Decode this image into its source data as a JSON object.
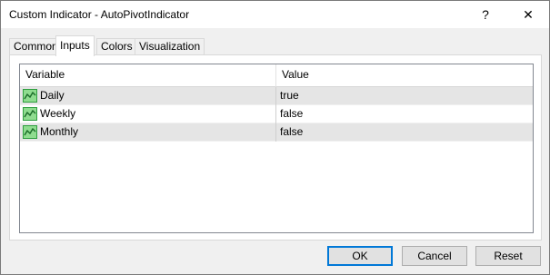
{
  "window": {
    "title": "Custom Indicator - AutoPivotIndicator",
    "help_label": "?",
    "close_label": "✕"
  },
  "tabs": [
    {
      "label": "Common",
      "active": false
    },
    {
      "label": "Inputs",
      "active": true
    },
    {
      "label": "Colors",
      "active": false
    },
    {
      "label": "Visualization",
      "active": false
    }
  ],
  "grid": {
    "headers": {
      "variable": "Variable",
      "value": "Value"
    },
    "rows": [
      {
        "variable": "Daily",
        "value": "true",
        "icon": "input-parameter-icon"
      },
      {
        "variable": "Weekly",
        "value": "false",
        "icon": "input-parameter-icon"
      },
      {
        "variable": "Monthly",
        "value": "false",
        "icon": "input-parameter-icon"
      }
    ]
  },
  "buttons": {
    "ok": "OK",
    "cancel": "Cancel",
    "reset": "Reset"
  },
  "colors": {
    "icon_green": "#2e9e3f",
    "icon_light": "#8fdc8f",
    "focus_blue": "#0078d7"
  }
}
